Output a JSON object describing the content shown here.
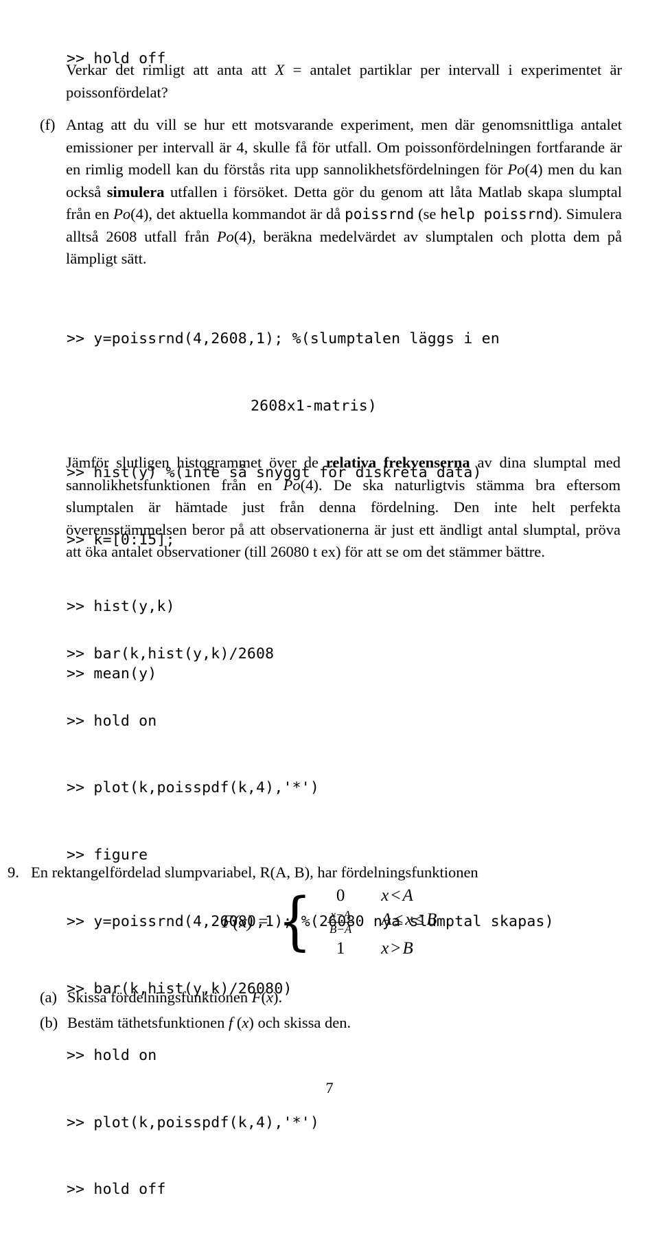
{
  "document": {
    "page_number": "7",
    "text_color": "#000000",
    "background_color": "#ffffff"
  },
  "top_code": {
    "lines": [
      ">> hold off"
    ]
  },
  "paragraph_verkar": {
    "part1": "Verkar det rimligt att anta att ",
    "math_X": "X",
    "equals": " = ",
    "part2": "antalet partiklar per intervall i experimentet är poissonfördelat?"
  },
  "item_f": {
    "label": "(f)",
    "s1": "Antag att du vill se hur ett motsvarande experiment, men där genomsnittliga antalet emissioner per intervall är 4, skulle få för utfall. Om poissonfördelningen fortfarande är en rimlig modell kan du förstås rita upp sannolikhetsfördelningen för ",
    "po1": "Po",
    "po1_arg": "(4)",
    "s2": " men du kan också ",
    "bold1": "simulera",
    "s3": " utfallen i försöket. Detta gör du genom att låta Matlab skapa slumptal från en ",
    "po2": "Po",
    "po2_arg": "(4)",
    "s4": ", det aktuella kommandot är då ",
    "mono1": "poissrnd",
    "s5": " (se ",
    "mono2": "help poissrnd",
    "s6": "). Simulera alltså 2608 utfall från ",
    "po3": "Po",
    "po3_arg": "(4)",
    "s7": ", beräkna medelvärdet av slumptalen och plotta dem på lämpligt sätt."
  },
  "code_block_1": {
    "lines": [
      ">> y=poissrnd(4,2608,1); %(slumptalen läggs i en",
      "2608x1-matris)",
      ">> hist(y) %(inte så snyggt för diskreta data)",
      ">> k=[0:15];",
      ">> hist(y,k)",
      ">> mean(y)"
    ],
    "continuation_indices": [
      1
    ]
  },
  "paragraph_jamfor": {
    "s1": "Jämför slutligen histogrammet över de ",
    "bold1": "relativa frekvenserna",
    "s2": " av dina slumptal med sannolikhetsfunktionen från en ",
    "po1": "Po",
    "po1_arg": "(4)",
    "s3": ". De ska naturligtvis stämma bra eftersom slumptalen är hämtade just från denna fördelning. Den inte helt perfekta överensstämmelsen beror på att observationerna är just ett ändligt antal slumptal, pröva att öka antalet observationer (till 26080 t ex) för att se om det stämmer bättre."
  },
  "code_block_2": {
    "lines": [
      ">> bar(k,hist(y,k)/2608",
      ">> hold on",
      ">> plot(k,poisspdf(k,4),'*')",
      ">> figure",
      ">> y=poissrnd(4,26080,1); %(26080 nya slumptal skapas)",
      ">> bar(k,hist(y,k)/26080)",
      ">> hold on",
      ">> plot(k,poisspdf(k,4),'*')",
      ">> hold off"
    ]
  },
  "item_9": {
    "label": "9.",
    "text": "En rektangelfördelad slumpvariabel, R(A, B), har fördelningsfunktionen"
  },
  "formula": {
    "lhs_f": "F",
    "lhs_open": "(",
    "lhs_x": "x",
    "lhs_close": ")",
    "equals": "=",
    "brace": "{",
    "cases": [
      {
        "value": "0",
        "value_type": "plain",
        "cond_left": "x",
        "cond_op": "<",
        "cond_right": "A"
      },
      {
        "value_num": "x−A",
        "value_den": "B−A",
        "value_type": "fraction",
        "cond_left": "A",
        "cond_op": "≤",
        "cond_mid": "x",
        "cond_op2": "≤",
        "cond_right": "B"
      },
      {
        "value": "1",
        "value_type": "plain",
        "cond_left": "x",
        "cond_op": ">",
        "cond_right": "B"
      }
    ]
  },
  "item_a": {
    "label": "(a)",
    "s1": "Skissa fördelningsfunktionen ",
    "math_F": "F",
    "math_open": "(",
    "math_x": "x",
    "math_close": ")",
    "s2": "."
  },
  "item_b": {
    "label": "(b)",
    "s1": "Bestäm täthetsfunktionen ",
    "math_f": "f",
    "math_open": " (",
    "math_x": "x",
    "math_close": ")",
    "s2": " och skissa den."
  }
}
